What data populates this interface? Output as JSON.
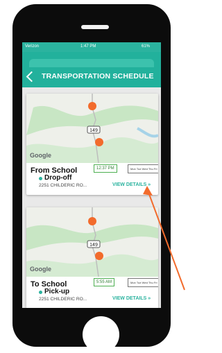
{
  "status": {
    "carrier": "Verizon",
    "time": "1:47 PM",
    "battery": "61%"
  },
  "header": {
    "title": "TRANSPORTATION SCHEDULE"
  },
  "cards": [
    {
      "title": "From School",
      "time": "12:37 PM",
      "days": "Mon Tue Wed Thu Fri",
      "type": "Drop-off",
      "address": "2251 CHILDERIC RO...",
      "details_label": "VIEW DETAILS »",
      "map_label": "Google",
      "route_number": "149"
    },
    {
      "title": "To School",
      "time": "5:55 AM",
      "days": "Mon Tue Wed Thu Fri",
      "type": "Pick-up",
      "address": "2251 CHILDERIC RO...",
      "details_label": "VIEW DETAILS »",
      "map_label": "Google",
      "route_number": "149"
    }
  ],
  "colors": {
    "accent": "#2bb39f",
    "marker": "#f26b2c",
    "time_border": "#4caf50"
  }
}
